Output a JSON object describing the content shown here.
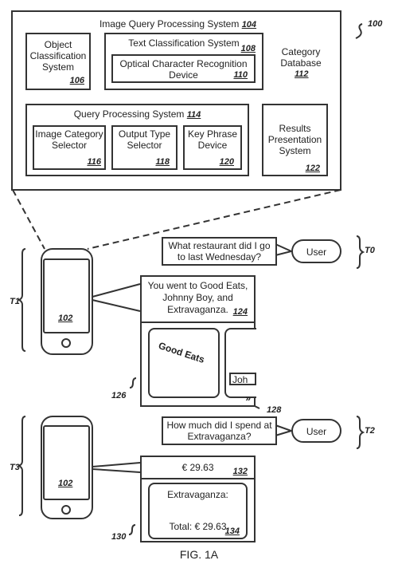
{
  "iqps": {
    "title": "Image Query Processing System",
    "ref": "104"
  },
  "fig_ref": "100",
  "ocs": {
    "label": "Object Classification System",
    "ref": "106"
  },
  "tcs": {
    "label": "Text Classification System",
    "ref": "108"
  },
  "ocr": {
    "label": "Optical Character Recognition Device",
    "ref": "110"
  },
  "db": {
    "label": "Category Database",
    "ref": "112"
  },
  "qps": {
    "label": "Query Processing System",
    "ref": "114"
  },
  "ics": {
    "label": "Image Category Selector",
    "ref": "116"
  },
  "ots": {
    "label": "Output Type Selector",
    "ref": "118"
  },
  "kpd": {
    "label": "Key Phrase Device",
    "ref": "120"
  },
  "rps": {
    "label": "Results Presentation System",
    "ref": "122"
  },
  "phone_ref": "102",
  "q1": {
    "text": "What restaurant did I go to last Wednesday?",
    "user": "User",
    "time": "T0"
  },
  "r1": {
    "text": "You went to Good Eats, Johnny Boy, and Extravaganza.",
    "ref": "124",
    "img1": "Good Eats",
    "img2": "Joh",
    "ref_card": "126",
    "ref_arrow": "128",
    "time": "T1"
  },
  "q2": {
    "text": "How much did I spend at Extravaganza?",
    "user": "User",
    "time": "T2"
  },
  "r2": {
    "amount": "€ 29.63",
    "ref": "132",
    "receipt_title": "Extravaganza:",
    "receipt_total": "Total: € 29.63",
    "ref_receipt": "134",
    "ref_card": "130",
    "time": "T3"
  },
  "caption": "FIG. 1A"
}
